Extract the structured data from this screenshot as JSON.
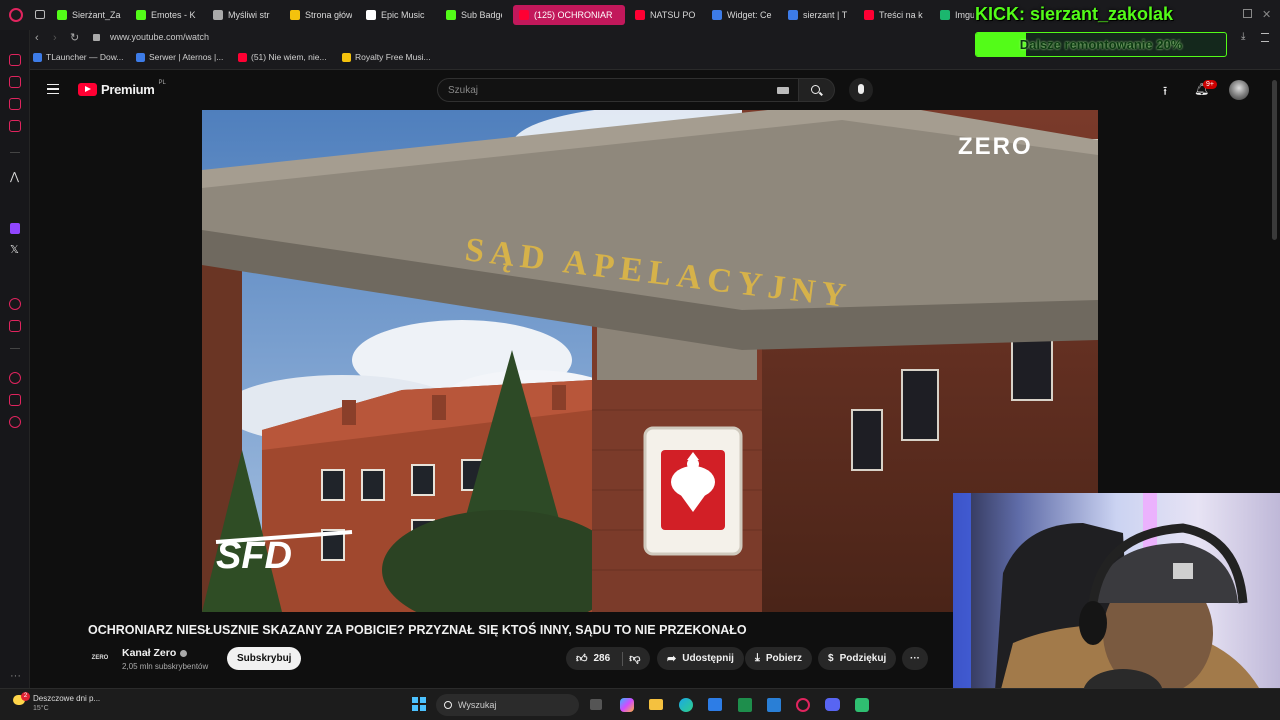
{
  "browser": {
    "tabs": [
      {
        "label": "Sierżant_Za",
        "color": "#53fc18"
      },
      {
        "label": "Emotes - K",
        "color": "#53fc18"
      },
      {
        "label": "Myśliwi str",
        "color": "#aaaaaa"
      },
      {
        "label": "Strona głów",
        "color": "#f4c20d"
      },
      {
        "label": "Epic Music",
        "color": "#ffffff"
      },
      {
        "label": "Sub Badge",
        "color": "#53fc18"
      },
      {
        "label": "(125) OCHRONIAR",
        "color": "#ff0033"
      },
      {
        "label": "NATSU PO",
        "color": "#ff0033"
      },
      {
        "label": "Widget: Ce",
        "color": "#3d7ce8"
      },
      {
        "label": "sierzant | T",
        "color": "#3d7ce8"
      },
      {
        "label": "Treści na k",
        "color": "#ff0033"
      },
      {
        "label": "Imgu",
        "color": "#1bb76e"
      }
    ],
    "url": "www.youtube.com/watch",
    "bookmarks": [
      {
        "label": "TLauncher — Dow...",
        "color": "#3d7ce8"
      },
      {
        "label": "Serwer | Aternos |...",
        "color": "#3d7ce8"
      },
      {
        "label": "(51) Nie wiem, nie...",
        "color": "#ff0033"
      },
      {
        "label": "Royalty Free Musi...",
        "color": "#f4c20d"
      }
    ]
  },
  "youtube": {
    "logo_text": "Premium",
    "logo_country": "PL",
    "search_placeholder": "Szukaj",
    "notification_badge": "9+",
    "video": {
      "sign_text": "SĄD APELACYJNY",
      "watermark": "ZERO",
      "corner_logo": "SFD"
    },
    "title": "OCHRONIARZ NIESŁUSZNIE SKAZANY ZA POBICIE? PRZYZNAŁ SIĘ KTOŚ INNY, SĄDU TO NIE PRZEKONAŁO",
    "channel": {
      "name": "Kanał Zero",
      "subscribers": "2,05 mln subskrybentów",
      "logo_text": "ZERO",
      "subscribe_label": "Subskrybuj"
    },
    "actions": {
      "likes": "286",
      "share_label": "Udostępnij",
      "download_label": "Pobierz",
      "thanks_label": "Podziękuj"
    }
  },
  "overlay": {
    "kick_title": "KICK: sierzant_zakolak",
    "progress_label": "Dalsze remontowanie 20%",
    "progress_fraction": 0.2,
    "accent": "#53fc18"
  },
  "taskbar": {
    "weather_title": "Deszczowe dni p...",
    "weather_temp": "15°C",
    "weather_badge": "2",
    "search_placeholder": "Wyszukaj"
  }
}
